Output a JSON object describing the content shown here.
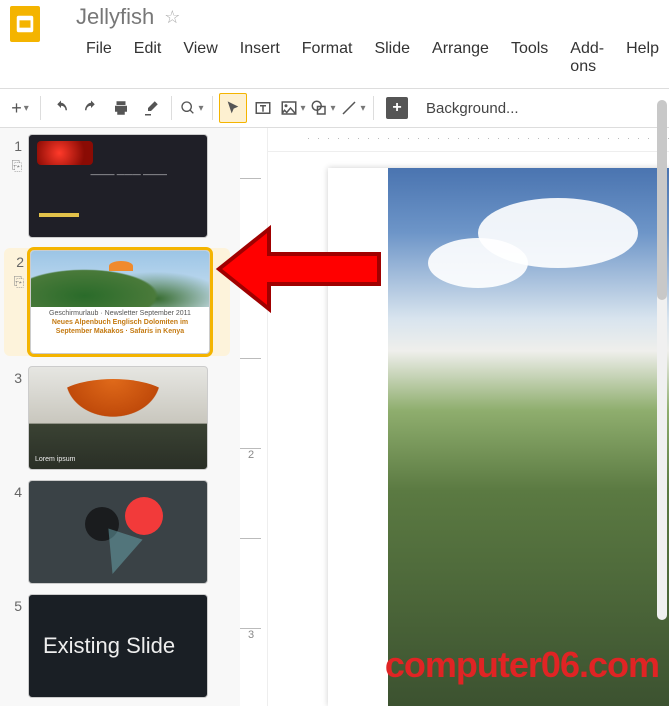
{
  "header": {
    "title": "Jellyfish",
    "star_icon": "☆"
  },
  "menus": [
    "File",
    "Edit",
    "View",
    "Insert",
    "Format",
    "Slide",
    "Arrange",
    "Tools",
    "Add-ons",
    "Help"
  ],
  "toolbar": {
    "new_slide": "+",
    "background": "Background...",
    "plus_box": "+"
  },
  "ruler_v": [
    "1",
    "",
    "2",
    "",
    "3",
    ""
  ],
  "slides": [
    {
      "num": "1",
      "caption_lines": "———\n———\n———"
    },
    {
      "num": "2",
      "caption": "Geschirmurlaub · Newsletter September 2011",
      "sub": "Neues Alpenbuch Englisch\nDolomiten im September\nMakakos · Safaris in Kenya"
    },
    {
      "num": "3",
      "label": "Lorem ipsum"
    },
    {
      "num": "4"
    },
    {
      "num": "5",
      "title": "Existing Slide"
    }
  ],
  "watermark": "computer06.com"
}
